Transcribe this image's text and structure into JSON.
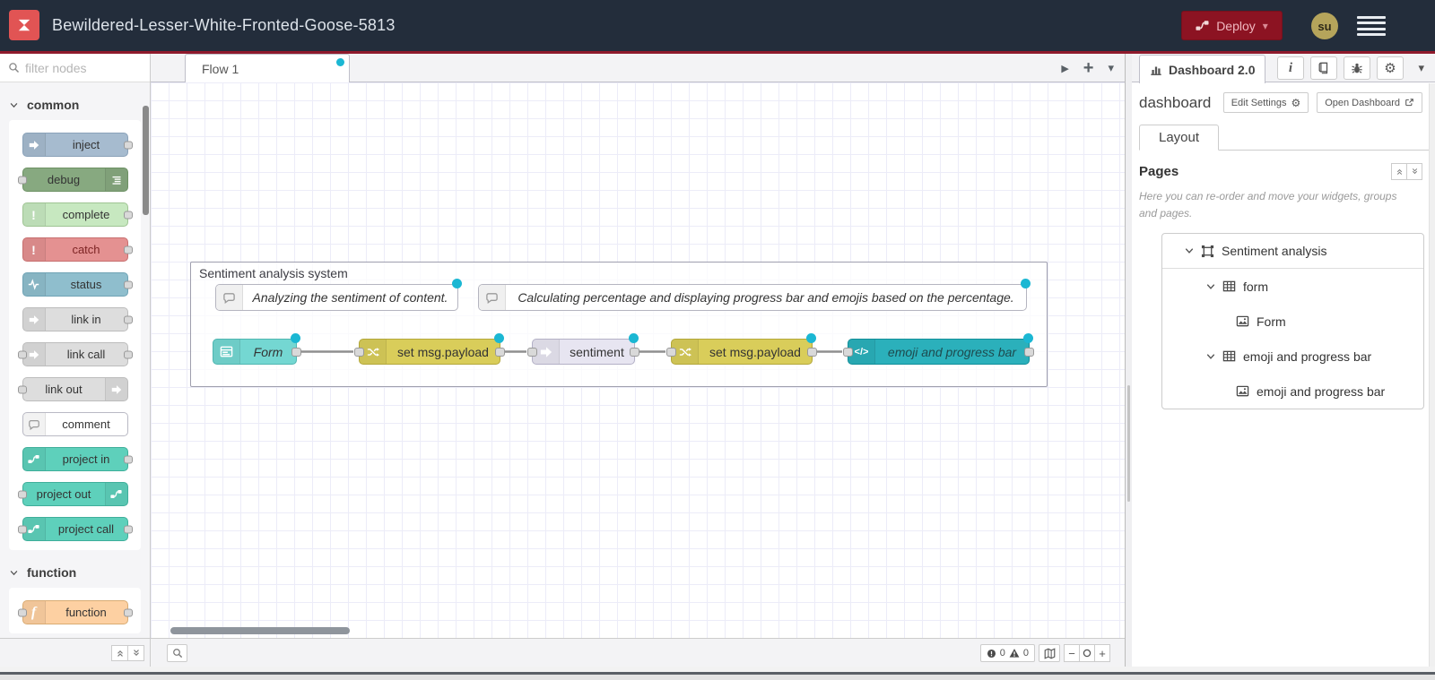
{
  "header": {
    "title": "Bewildered-Lesser-White-Fronted-Goose-5813",
    "deploy_label": "Deploy",
    "avatar_initials": "su",
    "colors": {
      "bar": "#232d3b",
      "accent_line": "#8f1a2c",
      "deploy_bg": "#8c1322",
      "logo_bg": "#e15454",
      "modified_dot": "#1bb7d3"
    }
  },
  "glyphs": {
    "gear": "⚙",
    "caret_down": "▾",
    "plus": "+",
    "minus": "−",
    "play": "▶",
    "exclamation": "!",
    "function_f": "f",
    "code": "</>",
    "info_i": "i"
  },
  "palette": {
    "filter_placeholder": "filter nodes",
    "categories": [
      {
        "label": "common",
        "nodes": [
          {
            "label": "inject",
            "color": "#a6bbcf",
            "border": "#8aa2b9"
          },
          {
            "label": "debug",
            "color": "#87a980",
            "border": "#6d9164"
          },
          {
            "label": "complete",
            "color": "#c7e8c0",
            "border": "#9fc493"
          },
          {
            "label": "catch",
            "color": "#e49191",
            "border": "#c76f6f",
            "text": "#7d2424"
          },
          {
            "label": "status",
            "color": "#8fbecd",
            "border": "#6fa3b5"
          },
          {
            "label": "link in",
            "color": "#dddddd",
            "border": "#bcbcbc"
          },
          {
            "label": "link call",
            "color": "#dddddd",
            "border": "#bcbcbc"
          },
          {
            "label": "link out",
            "color": "#dddddd",
            "border": "#bcbcbc"
          },
          {
            "label": "comment",
            "color": "#ffffff",
            "border": "#b9b9c4"
          },
          {
            "label": "project in",
            "color": "#5ed0bb",
            "border": "#3fae9a"
          },
          {
            "label": "project out",
            "color": "#5ed0bb",
            "border": "#3fae9a"
          },
          {
            "label": "project call",
            "color": "#5ed0bb",
            "border": "#3fae9a"
          }
        ]
      },
      {
        "label": "function",
        "nodes": [
          {
            "label": "function",
            "color": "#fdd0a2",
            "border": "#d9ab72"
          }
        ]
      }
    ]
  },
  "workspace": {
    "tabs": [
      {
        "label": "Flow 1",
        "modified": true
      }
    ],
    "group_label": "Sentiment analysis system",
    "comments": [
      {
        "label": "Analyzing the sentiment of content."
      },
      {
        "label": "Calculating percentage and displaying progress bar and emojis based on the percentage."
      }
    ],
    "nodes": [
      {
        "label": "Form",
        "color": "#74d7d2",
        "border": "#4fb6b1"
      },
      {
        "label": "set msg.payload",
        "color": "#d9cd5a",
        "border": "#b3a73a"
      },
      {
        "label": "sentiment",
        "color": "#e7e5f1",
        "border": "#b3b0c6"
      },
      {
        "label": "set msg.payload",
        "color": "#d9cd5a",
        "border": "#b3a73a"
      },
      {
        "label": "emoji and progress bar",
        "color": "#2bb0bb",
        "border": "#118e99"
      }
    ]
  },
  "sidebar": {
    "tab_label": "Dashboard 2.0",
    "title": "dashboard",
    "edit_settings_label": "Edit Settings",
    "open_dashboard_label": "Open Dashboard",
    "layout_tab": "Layout",
    "pages_title": "Pages",
    "help_text": "Here you can re-order and move your widgets, groups and pages.",
    "tree": [
      {
        "label": "Sentiment analysis",
        "icon": "page-icon"
      },
      {
        "label": "form",
        "icon": "group-icon"
      },
      {
        "label": "Form",
        "icon": "widget-icon"
      },
      {
        "label": "emoji and progress bar",
        "icon": "group-icon"
      },
      {
        "label": "emoji and progress bar",
        "icon": "widget-icon"
      }
    ]
  },
  "statusbar": {
    "error_count": "0",
    "warning_count": "0"
  }
}
